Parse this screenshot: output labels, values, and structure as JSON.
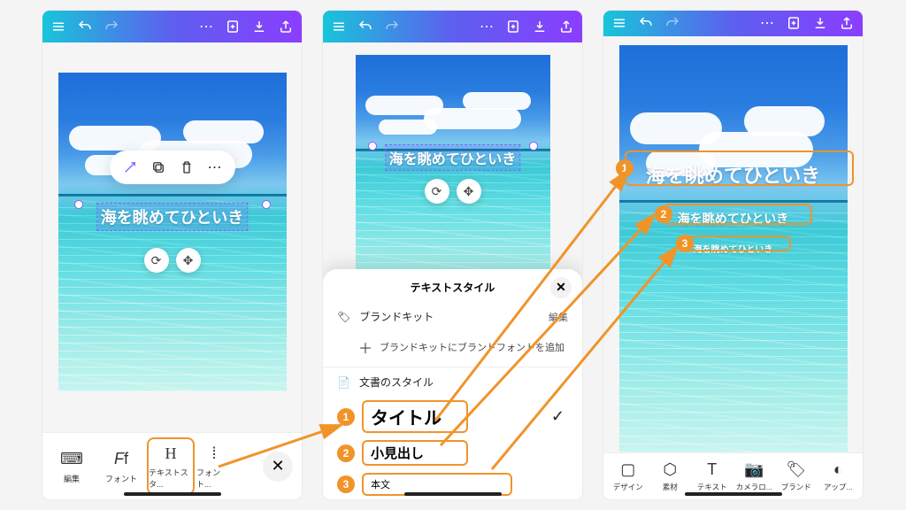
{
  "sample_text": "海を眺めてひといき",
  "toolbar": {
    "edit": "編集",
    "font": "フォント",
    "text_style": "テキストスタ...",
    "font_size": "フォント..."
  },
  "sheet": {
    "title": "テキストスタイル",
    "brand_kit": "ブランドキット",
    "edit_link": "編集",
    "brand_prompt": "ブランドキットにブランドフォントを追加",
    "doc_style": "文書のスタイル",
    "style_title": "タイトル",
    "style_subtitle": "小見出し",
    "style_body": "本文"
  },
  "nav": {
    "design": "デザイン",
    "elements": "素材",
    "text": "テキスト",
    "camera": "カメラロ...",
    "brand": "ブランド",
    "apps": "アップ..."
  },
  "badges": {
    "b1": "1",
    "b2": "2",
    "b3": "3"
  }
}
